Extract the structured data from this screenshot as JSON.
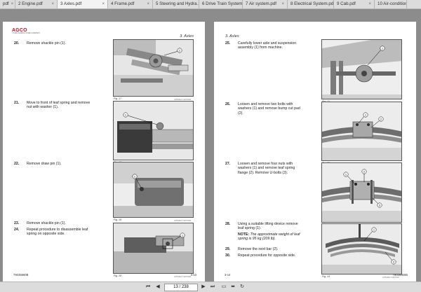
{
  "tabs": [
    {
      "label": "pdf"
    },
    {
      "label": "2 Engine.pdf"
    },
    {
      "label": "3 Axles.pdf"
    },
    {
      "label": "4 Frame.pdf"
    },
    {
      "label": "5 Steering and Hydra..."
    },
    {
      "label": "6 Drive Train System..."
    },
    {
      "label": "7 Air system.pdf"
    },
    {
      "label": "8 Electrical System.pdf"
    },
    {
      "label": "9 Cab.pdf"
    },
    {
      "label": "10 Air-condition"
    }
  ],
  "left_page": {
    "logo": "AGCO",
    "logo_sub": "YOUR AGRICULTURE COMPANY",
    "section": "3. Axles",
    "steps": [
      {
        "num": "20.",
        "text": "Remove shackle pin (1)."
      },
      {
        "num": "21.",
        "text": "Move to front of leaf spring and remove nut with washer (1)."
      },
      {
        "num": "22.",
        "text": "Remove draw pin (1)."
      },
      {
        "num": "23.",
        "text": "Remove shackle pin (1)."
      },
      {
        "num": "24.",
        "text": "Repeat procedure to disassemble leaf spring on opposite side."
      }
    ],
    "figures": [
      {
        "caption": "Fig. 17",
        "code": "AP5460173157903"
      },
      {
        "caption": "Fig. 18",
        "code": "AP5460173157904"
      },
      {
        "caption": "Fig. 19",
        "code": "AP5460173157905"
      },
      {
        "caption": "Fig. 20",
        "code": "AP5460173157906"
      }
    ],
    "footer_left": "79035960B",
    "footer_right": "3-13"
  },
  "right_page": {
    "section": "3. Axles",
    "steps": [
      {
        "num": "25.",
        "text": "Carefully lower axle and suspension assembly (1) from machine."
      },
      {
        "num": "26.",
        "text": "Loosen and remove two bolts with washers (1) and remove bump cut pad (2)."
      },
      {
        "num": "27.",
        "text": "Loosen and remove four nuts with washers (1) and remove leaf spring flange (2). Remove U-bolts (3)."
      },
      {
        "num": "28.",
        "text": "Using a suitable lifting device remove leaf spring (1)."
      },
      {
        "num": "29.",
        "text": "Remove the next bar (2)."
      },
      {
        "num": "30.",
        "text": "Repeat procedure for opposite side."
      }
    ],
    "note_label": "NOTE:",
    "note_text": "The approximate weight of leaf spring is 95 kg (209 lb).",
    "figures": [
      {
        "caption": "Fig. 21",
        "code": "AP5460173157907"
      },
      {
        "caption": "Fig. 22",
        "code": "AP5460173157908"
      },
      {
        "caption": "Fig. 23",
        "code": "AP5460173157909"
      },
      {
        "caption": "Fig. 24",
        "code": "AP5460173157910"
      }
    ],
    "footer_left": "3-14",
    "footer_right": "79035960B"
  },
  "statusbar": {
    "page_indicator": "13 / 238",
    "icons": [
      "first-page-icon",
      "previous-page-icon",
      "next-page-icon",
      "last-page-icon",
      "fit-page-icon",
      "fit-width-icon",
      "rotate-icon"
    ]
  },
  "colors": {
    "brand": "#c8102e",
    "page_bg": "#ffffff",
    "viewer_bg": "#8c8c8c",
    "callout": "#ffffff"
  }
}
